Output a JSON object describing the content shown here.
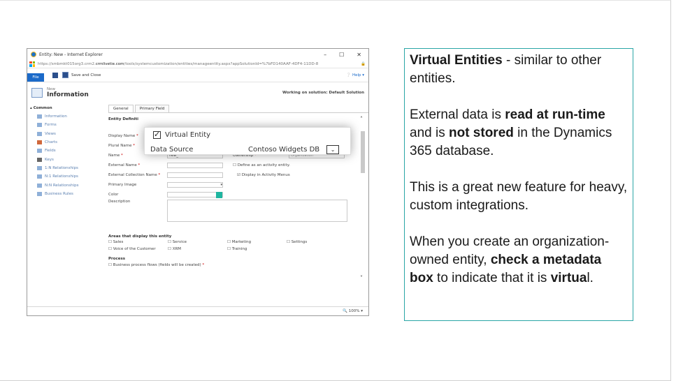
{
  "browser": {
    "window_title": "Entity: New - Internet Explorer",
    "controls": [
      "–",
      "☐",
      "✕"
    ],
    "url_prefix": "https://smbmkt015org3.crm2.",
    "url_domain": "crmlivetie.com",
    "url_rest": "/tools/systemcustomization/entities/manageentity.aspx?appSolutionId=%7bFD140AAF-4DF4-11DD-8",
    "zoom": "100%"
  },
  "crm": {
    "file_label": "File",
    "save_close_label": "Save and Close",
    "help_label": "Help",
    "header_new": "New",
    "header_title": "Information",
    "working_on": "Working on solution: Default Solution",
    "nav_group": "Common",
    "nav_items": [
      "Information",
      "Forms",
      "Views",
      "Charts",
      "Fields",
      "Keys",
      "1:N Relationships",
      "N:1 Relationships",
      "N:N Relationships",
      "Business Rules"
    ],
    "tabs": [
      "General",
      "Primary Field"
    ],
    "section_entity_definition": "Entity Definiti",
    "fields": {
      "display_name": "Display Name",
      "plural_name": "Plural Name",
      "name": "Name",
      "name_value": "new_",
      "external_name": "External Name",
      "external_collection_name": "External Collection Name",
      "primary_image": "Primary Image",
      "color": "Color",
      "description": "Description",
      "ownership": "Ownership",
      "ownership_value": "Organization",
      "define_activity": "Define as an activity entity.",
      "display_activity_menus": "Display in Activity Menus"
    },
    "areas_title": "Areas that display this entity",
    "areas": [
      "Sales",
      "Service",
      "Marketing",
      "Settings",
      "Voice of the Customer",
      "XRM",
      "Training"
    ],
    "process_title": "Process",
    "process_item": "Business process flows (fields will be created)"
  },
  "callout": {
    "virtual_entity_label": "Virtual Entity",
    "data_source_label": "Data Source",
    "data_source_value": "Contoso Widgets DB"
  },
  "panel": {
    "p1_bold": "Virtual Entities",
    "p1_rest": " - similar to other entities.",
    "p2_a": "External data is ",
    "p2_b": "read at run-time",
    "p2_c": " and is ",
    "p2_d": "not stored",
    "p2_e": " in the Dynamics 365 database.",
    "p3": "This is a great new feature for heavy, custom integrations.",
    "p4_a": "When you create an organization-owned entity, ",
    "p4_b": "check a metadata box",
    "p4_c": " to indicate that it is ",
    "p4_d": "virtua",
    "p4_e": "l."
  },
  "colors": {
    "panel_border": "#2aa6a6",
    "file_button": "#1b6ac9",
    "color_swatch": "#1fb5a0"
  }
}
